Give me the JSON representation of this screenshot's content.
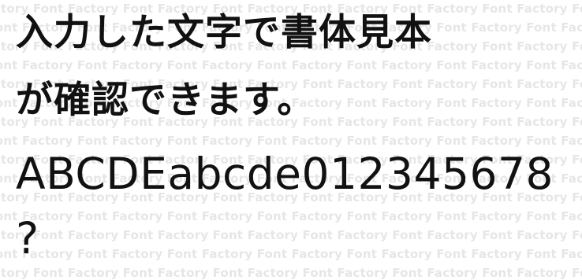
{
  "watermark": {
    "text": "Font Factory"
  },
  "sample": {
    "lines": [
      "入力した文字で書体見本",
      "が確認できます。",
      "ABCDEabcde012345678",
      "?"
    ]
  },
  "colors": {
    "background": "#ffffff",
    "text": "#111111",
    "watermark": "#e6e6e6"
  }
}
